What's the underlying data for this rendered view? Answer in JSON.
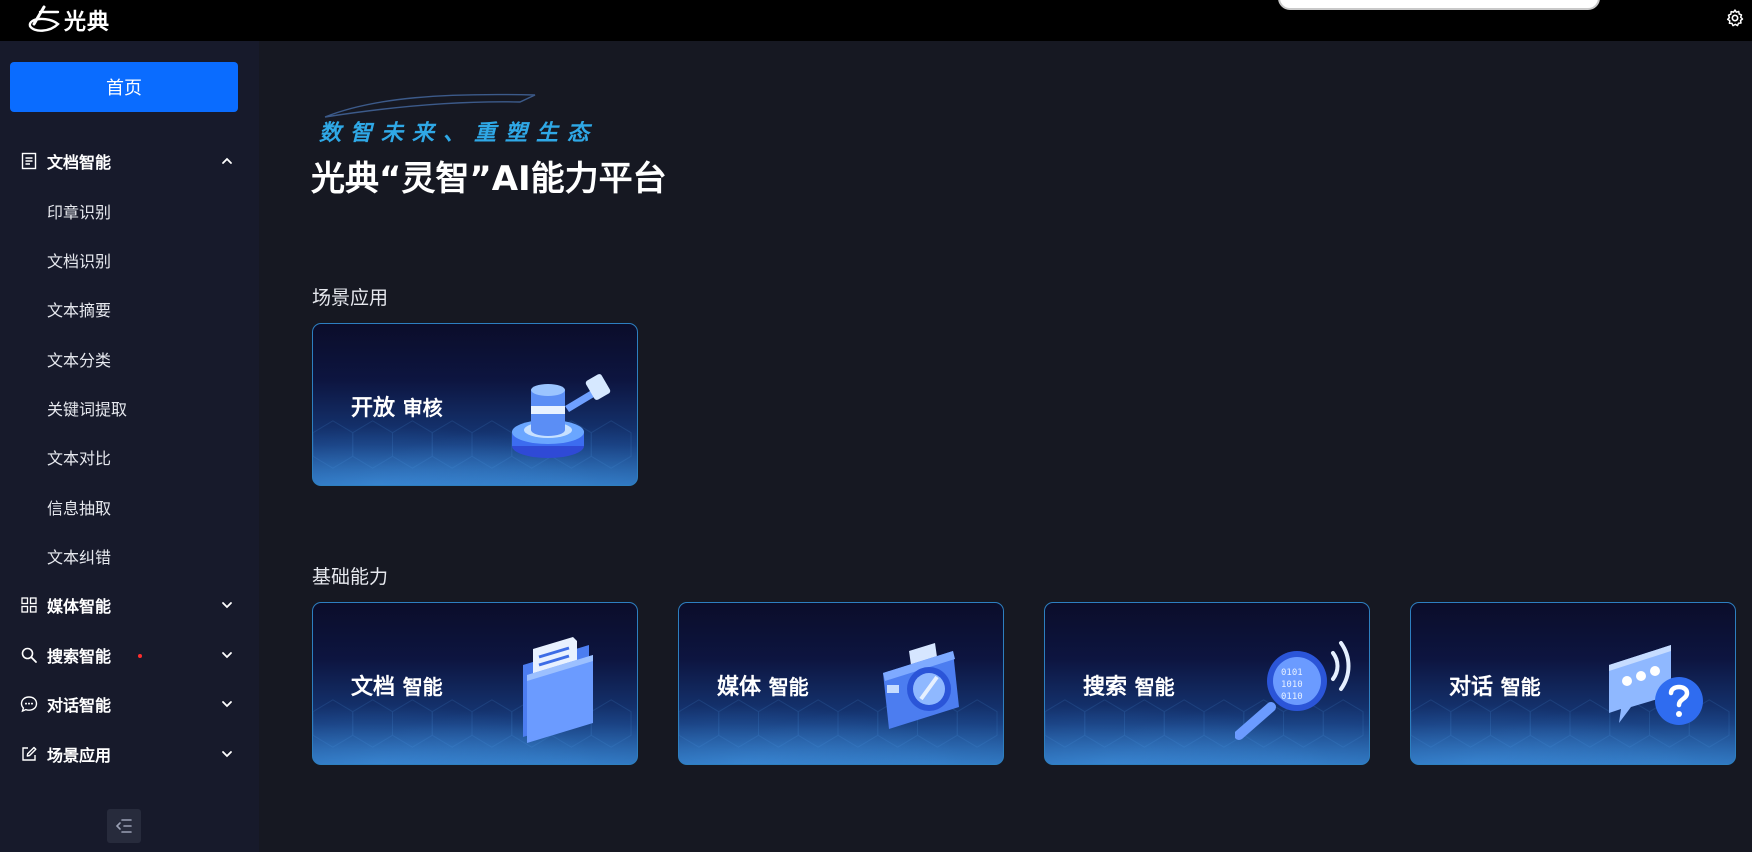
{
  "header": {
    "logo_text": "光典"
  },
  "sidebar": {
    "home_label": "首页",
    "groups": [
      {
        "label": "文档智能",
        "icon": "document-icon",
        "expanded": true
      },
      {
        "label": "媒体智能",
        "icon": "grid-icon",
        "expanded": false
      },
      {
        "label": "搜索智能",
        "icon": "search-icon",
        "expanded": false
      },
      {
        "label": "对话智能",
        "icon": "chat-icon",
        "expanded": false
      },
      {
        "label": "场景应用",
        "icon": "edit-icon",
        "expanded": false
      }
    ],
    "doc_items": [
      "印章识别",
      "文档识别",
      "文本摘要",
      "文本分类",
      "关键词提取",
      "文本对比",
      "信息抽取",
      "文本纠错"
    ]
  },
  "main": {
    "slogan": "数智未来、重塑生态",
    "title": "光典“灵智”AI能力平台",
    "section_scene": "场景应用",
    "section_basic": "基础能力",
    "scene_cards": [
      {
        "title": "开放",
        "sub": "审核",
        "icon": "gavel-icon"
      }
    ],
    "basic_cards": [
      {
        "title": "文档",
        "sub": "智能",
        "icon": "folder-icon"
      },
      {
        "title": "媒体",
        "sub": "智能",
        "icon": "camera-icon"
      },
      {
        "title": "搜索",
        "sub": "智能",
        "icon": "magnifier-icon"
      },
      {
        "title": "对话",
        "sub": "智能",
        "icon": "chat-bubble-icon"
      }
    ]
  },
  "colors": {
    "accent": "#0a6cff",
    "sidebar_bg": "#171a2b",
    "main_bg": "#161822",
    "slogan": "#2fa8e6"
  }
}
